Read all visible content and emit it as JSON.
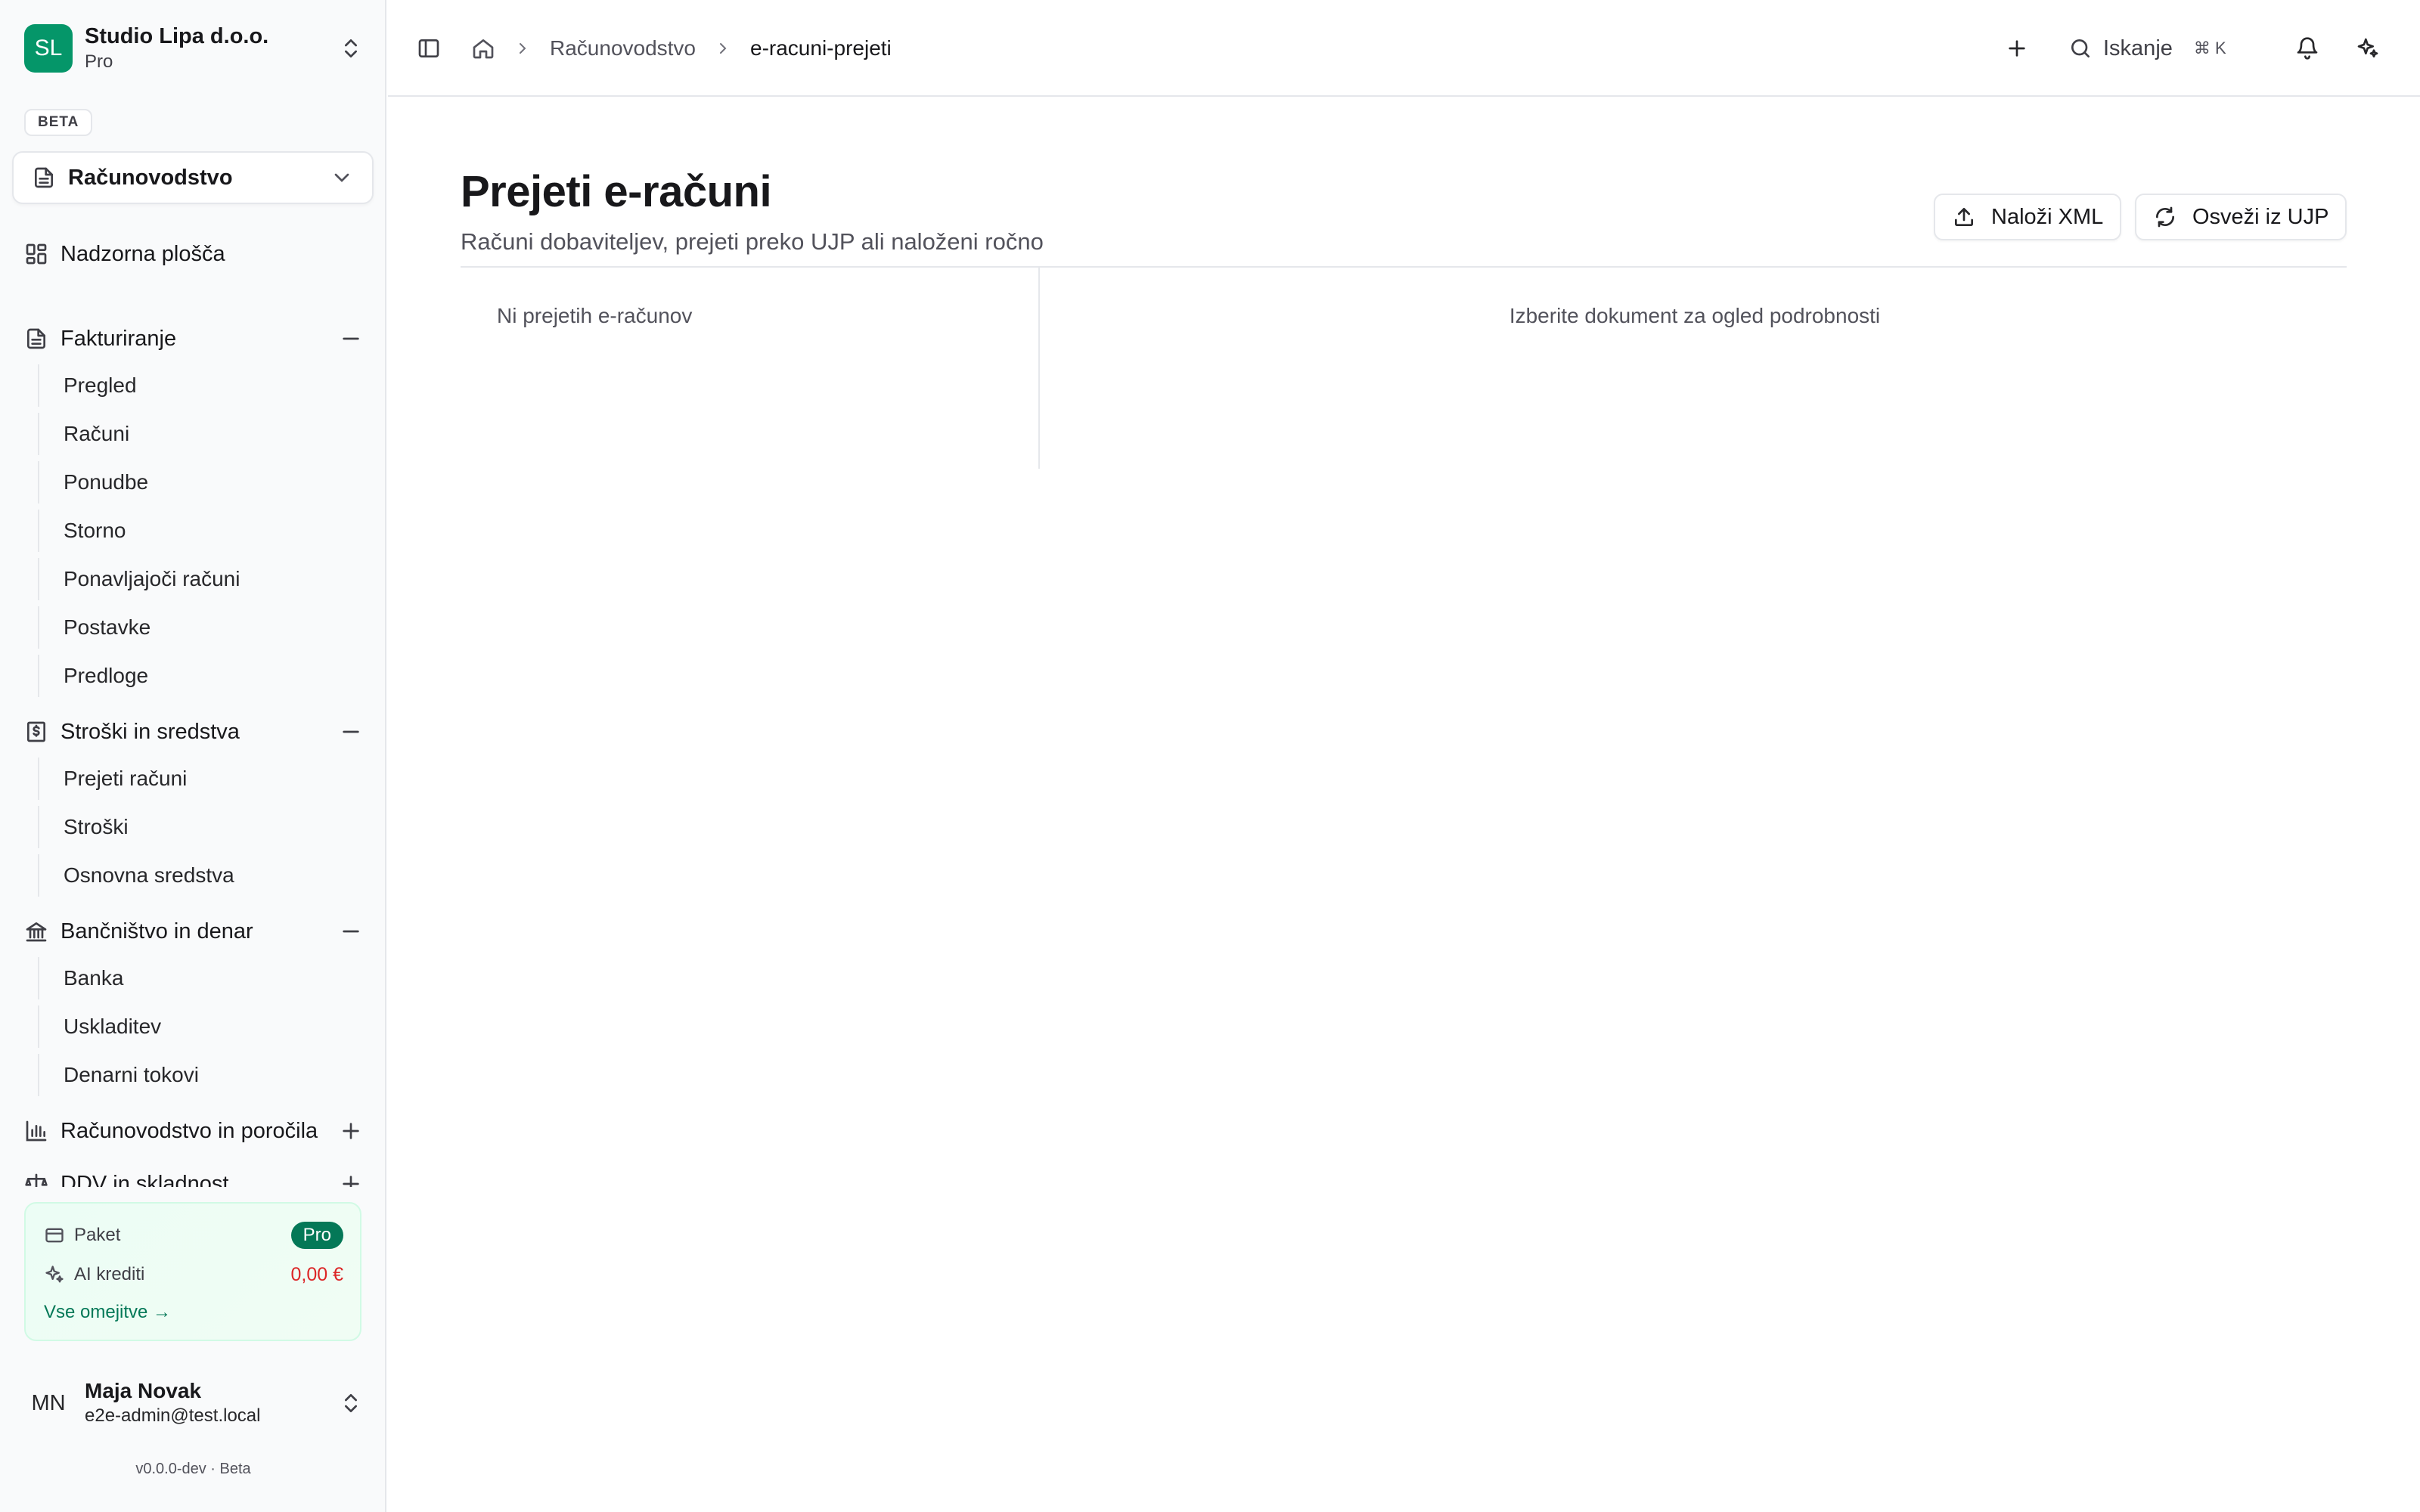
{
  "sidebar": {
    "org": {
      "initials": "SL",
      "name": "Studio Lipa d.o.o.",
      "plan": "Pro"
    },
    "beta_label": "BETA",
    "section_select": {
      "label": "Računovodstvo"
    },
    "nav": {
      "dashboard": "Nadzorna plošča",
      "groups": [
        {
          "label": "Fakturiranje",
          "items": [
            "Pregled",
            "Računi",
            "Ponudbe",
            "Storno",
            "Ponavljajoči računi",
            "Postavke",
            "Predloge"
          ]
        },
        {
          "label": "Stroški in sredstva",
          "items": [
            "Prejeti računi",
            "Stroški",
            "Osnovna sredstva"
          ]
        },
        {
          "label": "Bančništvo in denar",
          "items": [
            "Banka",
            "Uskladitev",
            "Denarni tokovi"
          ]
        },
        {
          "label": "Računovodstvo in poročila"
        },
        {
          "label": "DDV in skladnost"
        }
      ]
    },
    "plan_card": {
      "package_label": "Paket",
      "package_value": "Pro",
      "ai_label": "AI krediti",
      "ai_value": "0,00 €",
      "link": "Vse omejitve →"
    },
    "user": {
      "initials": "MN",
      "name": "Maja Novak",
      "email": "e2e-admin@test.local"
    },
    "version": "v0.0.0-dev · Beta"
  },
  "header": {
    "breadcrumbs": [
      "Računovodstvo",
      "e-racuni-prejeti"
    ],
    "search_label": "Iskanje",
    "search_shortcut": "⌘  K"
  },
  "main": {
    "title": "Prejeti e-računi",
    "subtitle": "Računi dobaviteljev, prejeti preko UJP ali naloženi ročno",
    "upload_button": "Naloži XML",
    "refresh_button": "Osveži iz UJP",
    "empty_list": "Ni prejetih e-računov",
    "empty_detail": "Izberite dokument za ogled podrobnosti"
  },
  "colors": {
    "brand": "#059669",
    "brand_dark": "#047857",
    "danger": "#dc2626",
    "border": "#e5e7eb"
  }
}
